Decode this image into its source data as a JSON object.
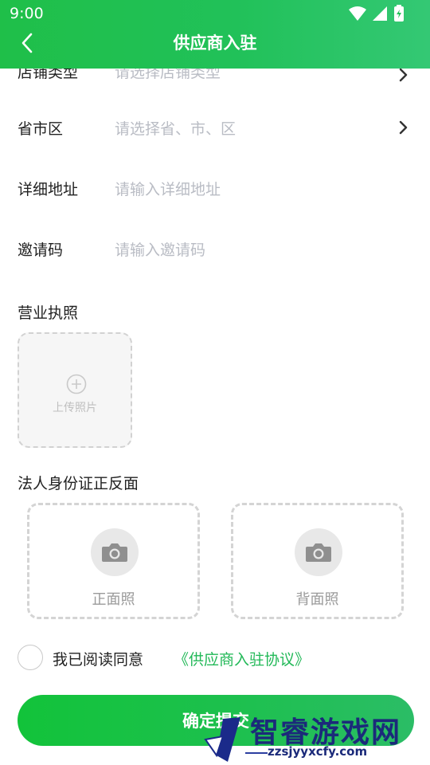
{
  "status_bar": {
    "time": "9:00"
  },
  "header": {
    "title": "供应商入驻"
  },
  "form": {
    "store_type": {
      "label": "店铺类型",
      "placeholder": "请选择店铺类型"
    },
    "region": {
      "label": "省市区",
      "placeholder": "请选择省、市、区"
    },
    "address": {
      "label": "详细地址",
      "placeholder": "请输入详细地址"
    },
    "invite_code": {
      "label": "邀请码",
      "placeholder": "请输入邀请码"
    }
  },
  "business_license": {
    "title": "营业执照",
    "upload_label": "上传照片"
  },
  "id_card": {
    "title": "法人身份证正反面",
    "front_label": "正面照",
    "back_label": "背面照"
  },
  "agreement": {
    "text": "我已阅读同意",
    "link": "《供应商入驻协议》"
  },
  "submit": {
    "label": "确定提交"
  },
  "watermark": {
    "title": "智睿游戏网",
    "url": "zzsjyyxcfy.com"
  },
  "colors": {
    "primary": "#21c159",
    "link": "#21b857"
  }
}
